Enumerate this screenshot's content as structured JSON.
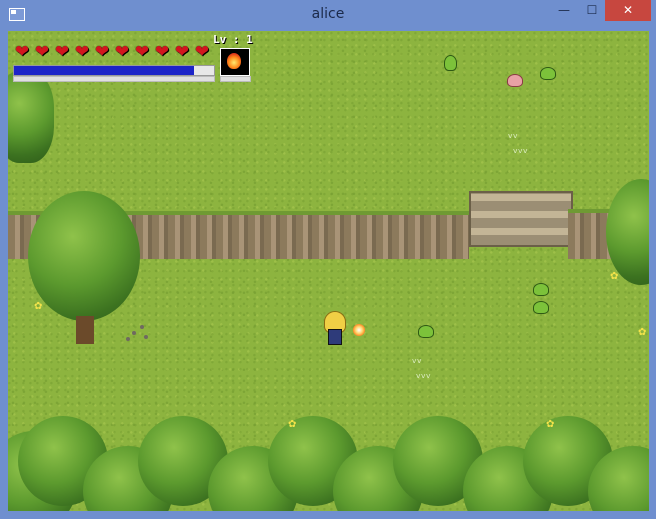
{
  "window": {
    "title": "alice",
    "minimize_glyph": "—",
    "maximize_glyph": "☐",
    "close_glyph": "✕"
  },
  "hud": {
    "hearts_count": 10,
    "heart_glyph": "❤",
    "mp_fraction": 0.9,
    "level_text": "Lv : 1",
    "skill_icon": "fire-icon"
  },
  "colors": {
    "heart": "#d2161e",
    "mp_bar": "#1d24c8",
    "grass": "#8db43f",
    "titlebar": "#6f8fcf",
    "close_button": "#c7473f"
  },
  "entities": {
    "enemies": [
      "slime",
      "pink-slime",
      "slime",
      "slime",
      "slime",
      "slime"
    ],
    "player": "alice-player",
    "projectile": "fireball"
  }
}
